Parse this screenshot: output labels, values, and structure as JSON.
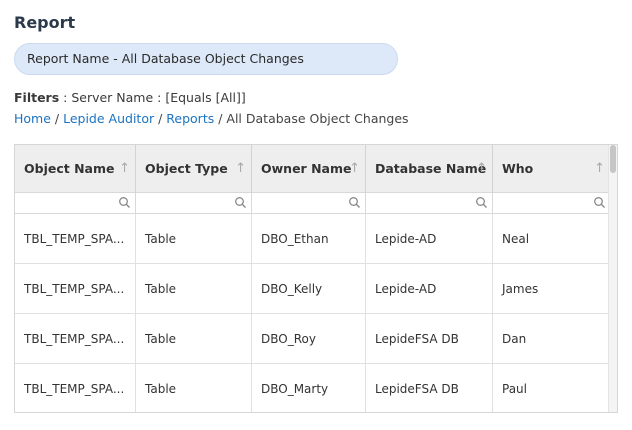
{
  "page": {
    "title": "Report",
    "report_name": "Report Name - All Database Object Changes",
    "filters_label": "Filters",
    "filters_value": " : Server Name : [Equals [All]]"
  },
  "breadcrumb": {
    "home": "Home",
    "auditor": "Lepide Auditor",
    "reports": "Reports",
    "current": "All Database Object Changes",
    "separator": " / "
  },
  "table": {
    "columns": [
      {
        "label": "Object Name",
        "sort_icon": "up-arrow-icon"
      },
      {
        "label": "Object Type",
        "sort_icon": "up-arrow-icon"
      },
      {
        "label": "Owner Name",
        "sort_icon": "up-arrow-icon"
      },
      {
        "label": "Database Name",
        "sort_icon": "up-arrow-icon"
      },
      {
        "label": "Who",
        "sort_icon": "up-arrow-icon"
      }
    ],
    "sort_glyph": "↑",
    "rows": [
      {
        "object_name": "TBL_TEMP_SPA...",
        "object_type": "Table",
        "owner_name": "DBO_Ethan",
        "database_name": "Lepide-AD",
        "who": "Neal"
      },
      {
        "object_name": "TBL_TEMP_SPA...",
        "object_type": "Table",
        "owner_name": "DBO_Kelly",
        "database_name": "Lepide-AD",
        "who": "James"
      },
      {
        "object_name": "TBL_TEMP_SPA...",
        "object_type": "Table",
        "owner_name": "DBO_Roy",
        "database_name": "LepideFSA DB",
        "who": "Dan"
      },
      {
        "object_name": "TBL_TEMP_SPA...",
        "object_type": "Table",
        "owner_name": "DBO_Marty",
        "database_name": "LepideFSA DB",
        "who": "Paul"
      }
    ]
  },
  "colors": {
    "link": "#1b73c2",
    "pill_bg": "#dde9f8",
    "header_bg": "#eeeeee",
    "title": "#2b3a4a"
  }
}
